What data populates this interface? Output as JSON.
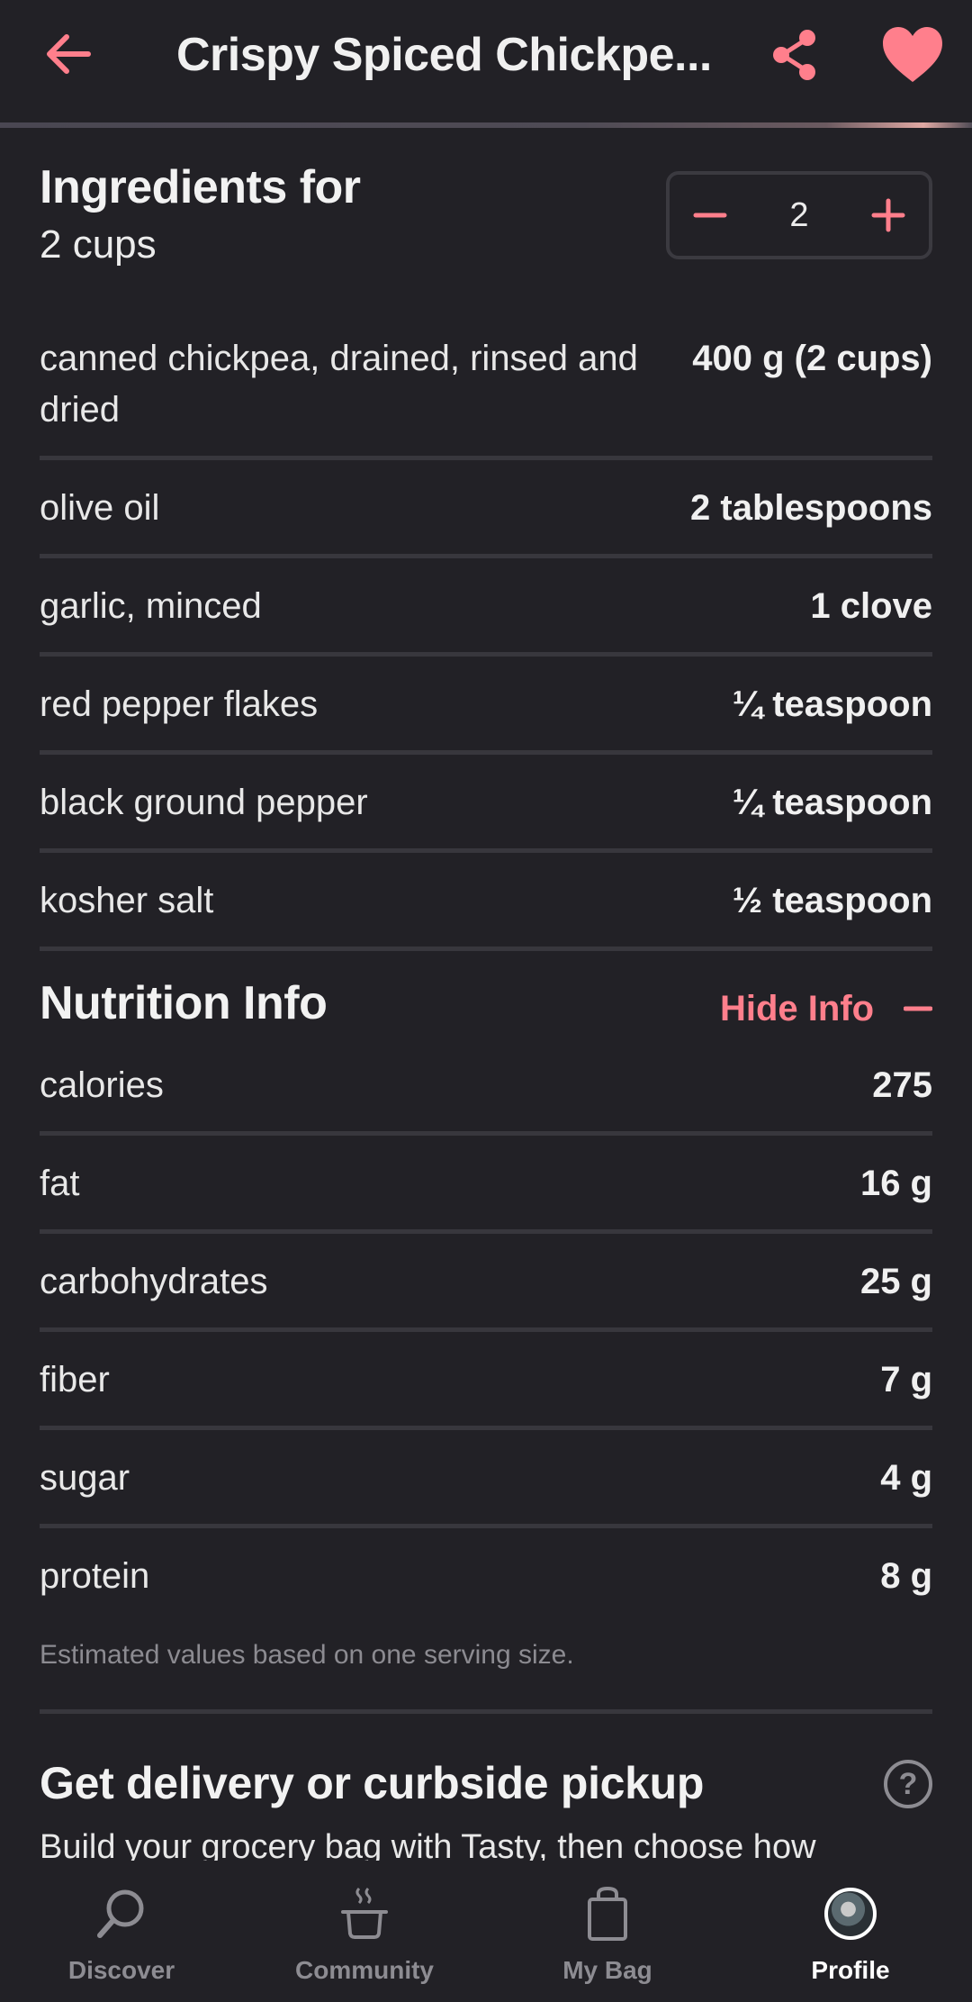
{
  "header": {
    "title": "Crispy Spiced Chickpe...",
    "accent": "#ff7f8c"
  },
  "ingredients": {
    "title": "Ingredients for",
    "subtitle": "2 cups",
    "stepper_value": "2",
    "items": [
      {
        "label": "canned chickpea, drained, rinsed and dried",
        "amount": "400 g (2 cups)"
      },
      {
        "label": "olive oil",
        "amount": "2 tablespoons"
      },
      {
        "label": "garlic, minced",
        "amount": "1 clove"
      },
      {
        "label": "red pepper flakes",
        "amount": "¼ teaspoon"
      },
      {
        "label": "black ground pepper",
        "amount": "¼ teaspoon"
      },
      {
        "label": "kosher salt",
        "amount": "½ teaspoon"
      }
    ]
  },
  "nutrition": {
    "title": "Nutrition Info",
    "hide_label": "Hide Info",
    "items": [
      {
        "label": "calories",
        "amount": "275"
      },
      {
        "label": "fat",
        "amount": "16 g"
      },
      {
        "label": "carbohydrates",
        "amount": "25 g"
      },
      {
        "label": "fiber",
        "amount": "7 g"
      },
      {
        "label": "sugar",
        "amount": "4 g"
      },
      {
        "label": "protein",
        "amount": "8 g"
      }
    ],
    "note": "Estimated values based on one serving size."
  },
  "delivery": {
    "title": "Get delivery or curbside pickup",
    "subtitle": "Build your grocery bag with Tasty, then choose how",
    "help_icon": "?"
  },
  "tabs": [
    {
      "label": "Discover",
      "icon": "search-icon"
    },
    {
      "label": "Community",
      "icon": "pot-icon"
    },
    {
      "label": "My Bag",
      "icon": "bag-icon"
    },
    {
      "label": "Profile",
      "icon": "avatar"
    }
  ]
}
